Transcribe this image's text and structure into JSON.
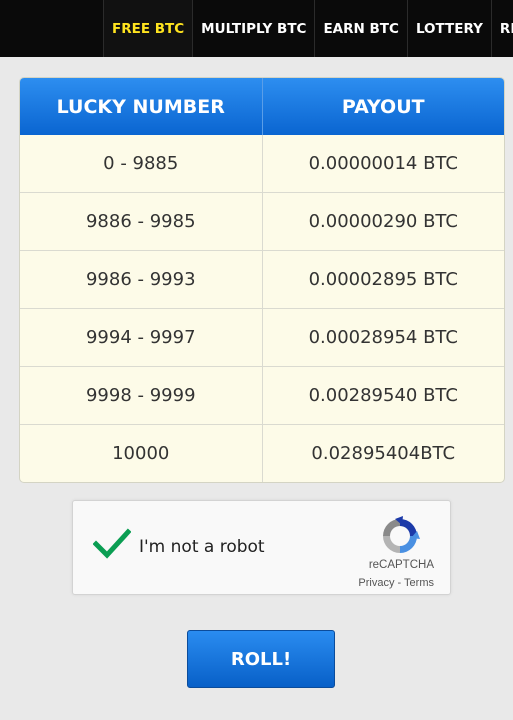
{
  "nav": {
    "items": [
      {
        "label": "FREE BTC",
        "active": true
      },
      {
        "label": "MULTIPLY BTC"
      },
      {
        "label": "EARN BTC"
      },
      {
        "label": "LOTTERY"
      },
      {
        "label": "RE"
      }
    ],
    "active_color": "#ffe41f"
  },
  "payout_table": {
    "headers": [
      "LUCKY NUMBER",
      "PAYOUT"
    ],
    "rows": [
      [
        "0 - 9885",
        "0.00000014 BTC"
      ],
      [
        "9886 - 9985",
        "0.00000290 BTC"
      ],
      [
        "9986 - 9993",
        "0.00002895 BTC"
      ],
      [
        "9994 - 9997",
        "0.00028954 BTC"
      ],
      [
        "9998 - 9999",
        "0.00289540 BTC"
      ],
      [
        "10000",
        "0.02895404BTC"
      ]
    ]
  },
  "captcha": {
    "label": "I'm not a robot",
    "brand": "reCAPTCHA",
    "privacy": "Privacy",
    "separator": " - ",
    "terms": "Terms",
    "checked": true,
    "check_icon": "checkmark-icon",
    "logo_icon": "recaptcha-logo-icon"
  },
  "roll_button": {
    "label": "ROLL!"
  },
  "colors": {
    "header_blue": "#0a65d1",
    "row_bg": "#fdfbe8",
    "check_green": "#0b9e53"
  }
}
